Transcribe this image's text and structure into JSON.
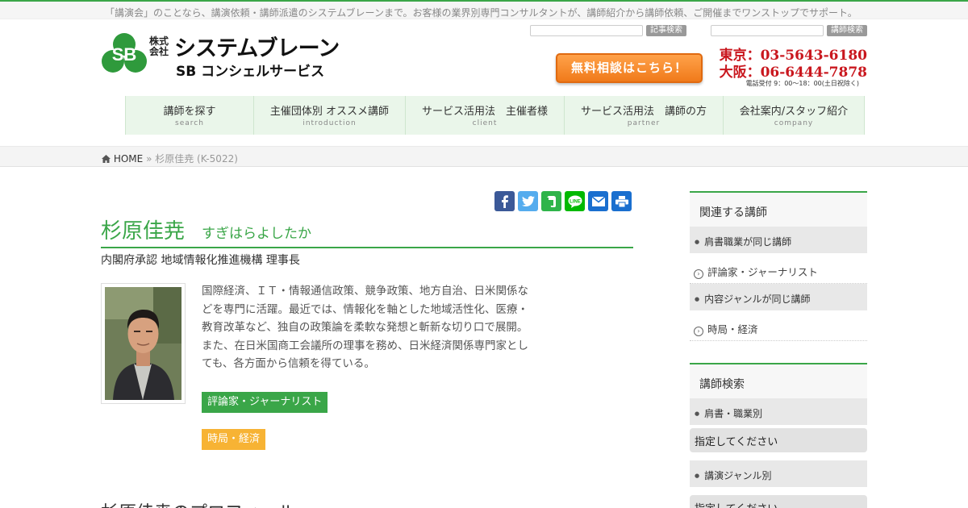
{
  "tagline": "「講演会」のことなら、講演依頼・講師派遣のシステムブレーンまで。お客様の業界別専門コンサルタントが、講師紹介から講師依頼、ご開催までワンストップでサポート。",
  "logo": {
    "kaisha": "株式会社",
    "name": "システムブレーン",
    "sub": "SB コンシェルサービス"
  },
  "header": {
    "article_search_label": "記事検索",
    "speaker_search_label": "講師検索",
    "cta_label": "無料相談はこちら！",
    "tokyo_phone": "東京：03-5643-6180",
    "osaka_phone": "大阪：06-6444-7878",
    "hours": "電話受付 9：00～18：00(土日祝除く)"
  },
  "nav": [
    {
      "label": "講師を探す",
      "sub": "search"
    },
    {
      "label": "主催団体別 オススメ講師",
      "sub": "introduction"
    },
    {
      "label": "サービス活用法　主催者様",
      "sub": "client"
    },
    {
      "label": "サービス活用法　講師の方",
      "sub": "partner"
    },
    {
      "label": "会社案内/スタッフ紹介",
      "sub": "company"
    }
  ],
  "breadcrumb": {
    "home": "HOME",
    "sep": "»",
    "current": "杉原佳尭 (K-5022)"
  },
  "share": [
    "facebook-icon",
    "twitter-icon",
    "evernote-icon",
    "line-icon",
    "mail-icon",
    "print-icon"
  ],
  "colors": {
    "accent_green": "#3aa648",
    "cta_orange": "#f07a1a",
    "phone_red": "#c9171e",
    "tag_orange": "#f7b334"
  },
  "profile": {
    "name": "杉原佳尭",
    "kana": "すぎはらよしたか",
    "title": "内閣府承認 地域情報化推進機構 理事長",
    "bio": [
      "国際経済、ＩＴ・情報通信政策、競争政策、地方自治、日米関係な",
      "どを専門に活躍。最近では、情報化を軸とした地域活性化、医療・",
      "教育改革など、独自の政策論を柔軟な発想と斬新な切り口で展開。",
      "また、在日米国商工会議所の理事を務め、日米経済関係専門家とし",
      "ても、各方面から信頼を得ている。"
    ],
    "tag_category": "評論家・ジャーナリスト",
    "tag_genre": "時局・経済",
    "section_heading": "杉原佳尭のプロフィール"
  },
  "sidebar": {
    "related_title": "関連する講師",
    "same_title_label": "肩書職業が同じ講師",
    "same_title_link": "評論家・ジャーナリスト",
    "same_genre_label": "内容ジャンルが同じ講師",
    "same_genre_link": "時局・経済",
    "search_title": "講師検索",
    "by_title_label": "肩書・職業別",
    "select_placeholder": "指定してください",
    "by_genre_label": "講演ジャンル別"
  }
}
